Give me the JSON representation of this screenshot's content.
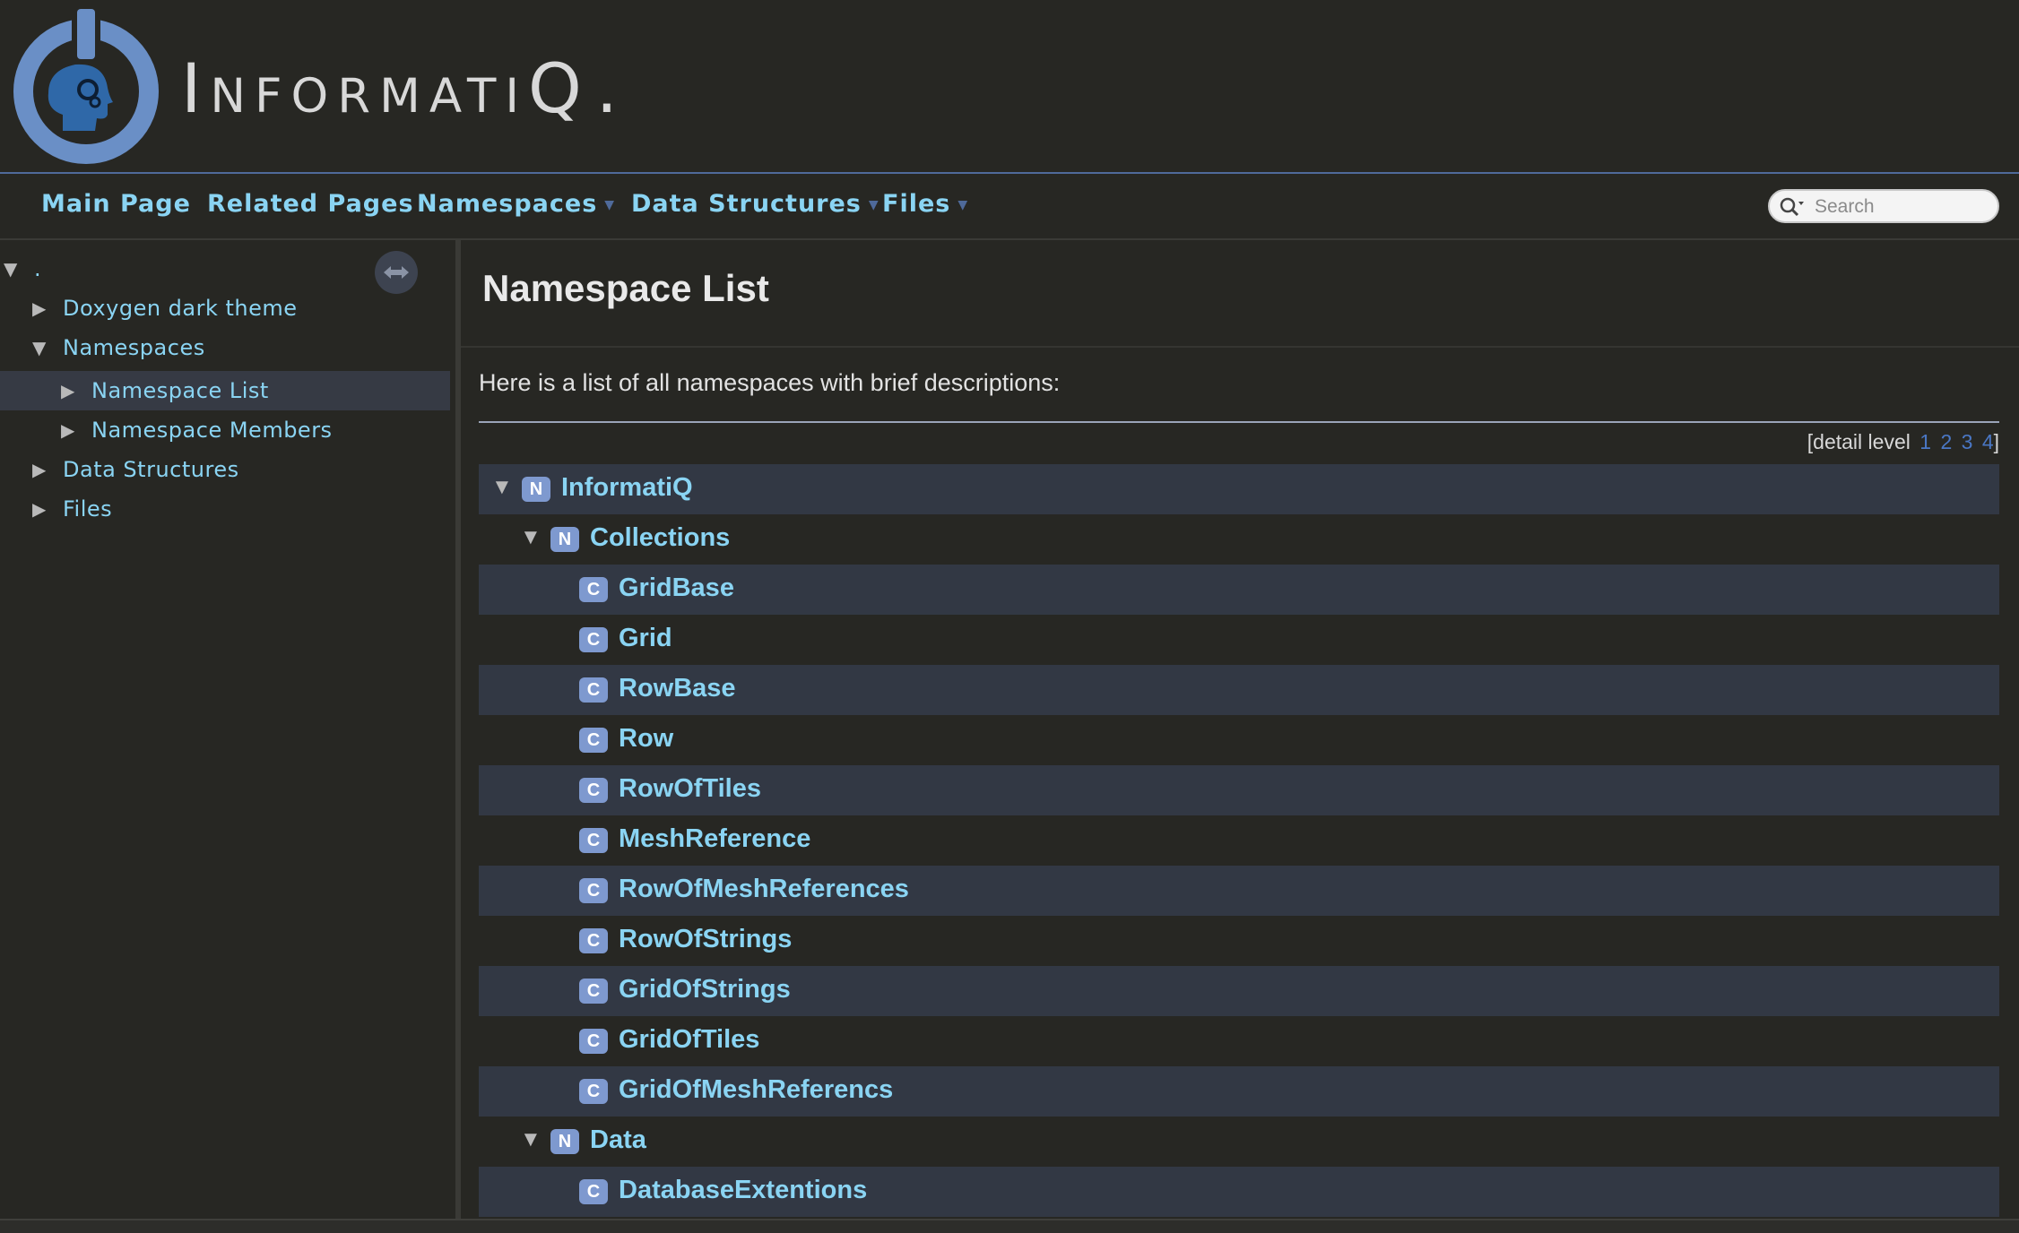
{
  "header": {
    "brand": "InformatiQ",
    "brand_dot": "."
  },
  "nav": {
    "items": [
      {
        "label": "Main Page",
        "dropdown": false
      },
      {
        "label": "Related Pages",
        "dropdown": false
      },
      {
        "label": "Namespaces",
        "dropdown": true
      },
      {
        "label": "Data Structures",
        "dropdown": true
      },
      {
        "label": "Files",
        "dropdown": true
      }
    ],
    "search_placeholder": "Search"
  },
  "sidebar": {
    "items": [
      {
        "label": ".",
        "arrow": "▼"
      },
      {
        "label": "Doxygen dark theme",
        "arrow": "▶"
      },
      {
        "label": "Namespaces",
        "arrow": "▼"
      },
      {
        "label": "Namespace List",
        "arrow": "▶",
        "selected": true
      },
      {
        "label": "Namespace Members",
        "arrow": "▶"
      },
      {
        "label": "Data Structures",
        "arrow": "▶"
      },
      {
        "label": "Files",
        "arrow": "▶"
      }
    ]
  },
  "main": {
    "title": "Namespace List",
    "intro": "Here is a list of all namespaces with brief descriptions:",
    "detail_level": {
      "prefix": "[detail level",
      "levels": [
        "1",
        "2",
        "3",
        "4"
      ],
      "suffix": "]"
    },
    "rows": [
      {
        "kind": "N",
        "name": "InformatiQ",
        "arrow": "▼"
      },
      {
        "kind": "N",
        "name": "Collections",
        "arrow": "▼"
      },
      {
        "kind": "C",
        "name": "GridBase"
      },
      {
        "kind": "C",
        "name": "Grid"
      },
      {
        "kind": "C",
        "name": "RowBase"
      },
      {
        "kind": "C",
        "name": "Row"
      },
      {
        "kind": "C",
        "name": "RowOfTiles"
      },
      {
        "kind": "C",
        "name": "MeshReference"
      },
      {
        "kind": "C",
        "name": "RowOfMeshReferences"
      },
      {
        "kind": "C",
        "name": "RowOfStrings"
      },
      {
        "kind": "C",
        "name": "GridOfStrings"
      },
      {
        "kind": "C",
        "name": "GridOfTiles"
      },
      {
        "kind": "C",
        "name": "GridOfMeshReferencs"
      },
      {
        "kind": "N",
        "name": "Data",
        "arrow": "▼"
      },
      {
        "kind": "C",
        "name": "DatabaseExtentions"
      }
    ]
  },
  "colors": {
    "background": "#272723",
    "link": "#8ad4f3",
    "accent": "#4f6a9a",
    "badge": "#7e99cf",
    "row_shade": "#323844"
  }
}
